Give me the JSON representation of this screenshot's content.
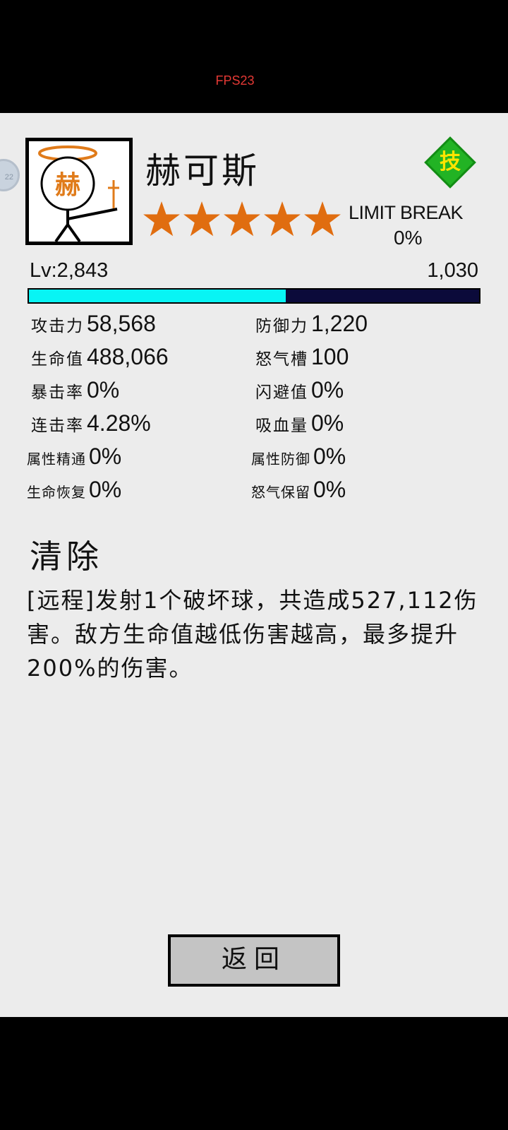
{
  "fps_label": "FPS23",
  "side_bubble_text": "22",
  "hero": {
    "portrait_char": "赫",
    "name": "赫可斯",
    "stars": 5,
    "skill_badge": "技",
    "limit_break_label": "LIMIT BREAK",
    "limit_break_value": "0%",
    "level": "Lv:2,843",
    "exp_value": "1,030",
    "exp_fraction": 0.57
  },
  "stats": [
    {
      "label": "攻击力",
      "value": "58,568"
    },
    {
      "label": "防御力",
      "value": "1,220"
    },
    {
      "label": "生命值",
      "value": "488,066"
    },
    {
      "label": "怒气槽",
      "value": "100"
    },
    {
      "label": "暴击率",
      "value": "0%"
    },
    {
      "label": "闪避值",
      "value": "0%"
    },
    {
      "label": "连击率",
      "value": "4.28%"
    },
    {
      "label": "吸血量",
      "value": "0%"
    },
    {
      "label": "属性精通",
      "value": "0%"
    },
    {
      "label": "属性防御",
      "value": "0%"
    },
    {
      "label": "生命恢复",
      "value": "0%"
    },
    {
      "label": "怒气保留",
      "value": "0%"
    }
  ],
  "skill": {
    "title": "清除",
    "description": "[远程]发射1个破坏球，共造成527,112伤害。敌方生命值越低伤害越高，最多提升200%的伤害。"
  },
  "back_button": "返回",
  "colors": {
    "star": "#e06d10",
    "exp_fill": "#08f4f4",
    "exp_track": "#0b0a3a",
    "skill_badge": "#22b324",
    "portrait_accent": "#e07b1a"
  }
}
